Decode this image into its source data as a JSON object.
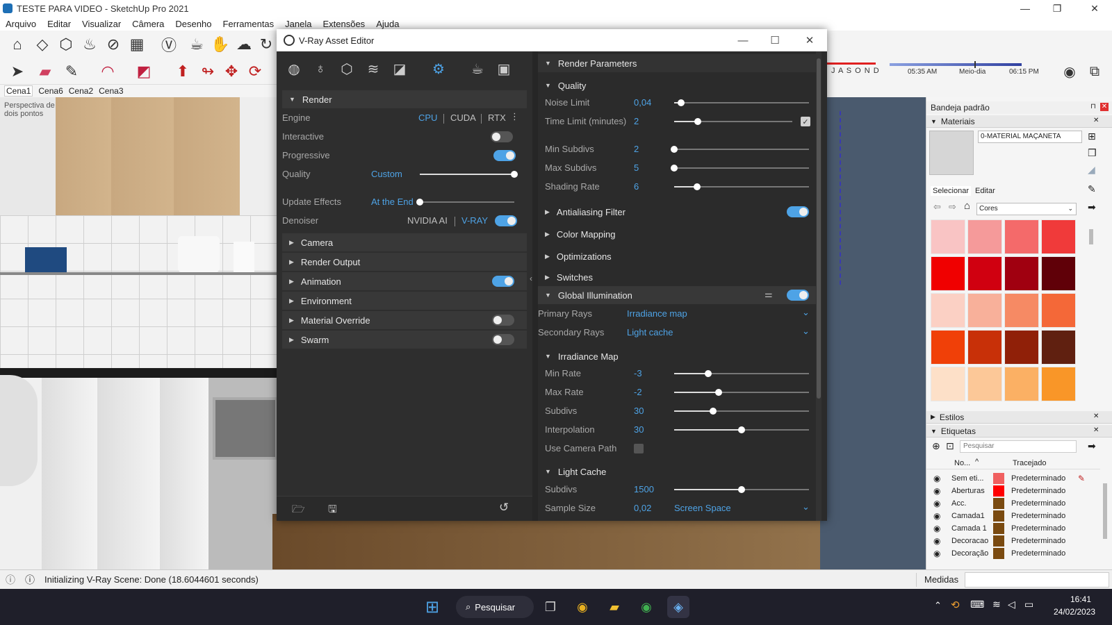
{
  "window": {
    "title": "TESTE PARA VIDEO - SketchUp Pro 2021",
    "minimize": "—",
    "maximize": "❐",
    "close": "✕"
  },
  "menu": [
    "Arquivo",
    "Editar",
    "Visualizar",
    "Câmera",
    "Desenho",
    "Ferramentas",
    "Janela",
    "Extensões",
    "Ajuda"
  ],
  "scenes": [
    "Cena1",
    "Cena6",
    "Cena2",
    "Cena3"
  ],
  "viewport": {
    "label": "Perspectiva de dois pontos"
  },
  "shadow": {
    "months": "J  A  S  O  N  D",
    "time_start": "05:35 AM",
    "time_mid": "Meio-dia",
    "time_end": "06:15 PM"
  },
  "vray": {
    "title": "V-Ray Asset Editor",
    "left": {
      "render": {
        "header": "Render",
        "engine_label": "Engine",
        "engine_cpu": "CPU",
        "engine_cuda": "CUDA",
        "engine_rtx": "RTX",
        "interactive_label": "Interactive",
        "interactive_on": false,
        "progressive_label": "Progressive",
        "progressive_on": true,
        "quality_label": "Quality",
        "quality_value": "Custom",
        "quality_level": 1.0,
        "update_label": "Update Effects",
        "update_value": "At the End",
        "update_level": 0.0,
        "denoiser_label": "Denoiser",
        "denoiser_nvidia": "NVIDIA AI",
        "denoiser_vray": "V-RAY",
        "denoiser_on": true
      },
      "sections": [
        {
          "label": "Camera",
          "toggle": null
        },
        {
          "label": "Render Output",
          "toggle": null
        },
        {
          "label": "Animation",
          "toggle": true
        },
        {
          "label": "Environment",
          "toggle": null
        },
        {
          "label": "Material Override",
          "toggle": false
        },
        {
          "label": "Swarm",
          "toggle": false
        }
      ]
    },
    "right": {
      "header": "Render Parameters",
      "quality": {
        "header": "Quality",
        "rows": [
          {
            "label": "Noise Limit",
            "value": "0,04",
            "level": 0.05
          },
          {
            "label": "Time Limit (minutes)",
            "value": "2",
            "level": 0.2
          },
          {
            "label": "Min Subdivs",
            "value": "2",
            "level": 0.0
          },
          {
            "label": "Max Subdivs",
            "value": "5",
            "level": 0.0
          },
          {
            "label": "Shading Rate",
            "value": "6",
            "level": 0.17
          }
        ]
      },
      "collapsed": [
        {
          "label": "Antialiasing Filter",
          "toggle": true
        },
        {
          "label": "Color Mapping",
          "toggle": null
        },
        {
          "label": "Optimizations",
          "toggle": null
        },
        {
          "label": "Switches",
          "toggle": null
        }
      ],
      "gi": {
        "header": "Global Illumination",
        "toggle": true,
        "primary_label": "Primary Rays",
        "primary_value": "Irradiance map",
        "secondary_label": "Secondary Rays",
        "secondary_value": "Light cache"
      },
      "irradiance": {
        "header": "Irradiance Map",
        "rows": [
          {
            "label": "Min Rate",
            "value": "-3",
            "level": 0.25
          },
          {
            "label": "Max Rate",
            "value": "-2",
            "level": 0.33
          },
          {
            "label": "Subdivs",
            "value": "30",
            "level": 0.29
          },
          {
            "label": "Interpolation",
            "value": "30",
            "level": 0.5
          }
        ],
        "camera_path_label": "Use Camera Path"
      },
      "lightcache": {
        "header": "Light Cache",
        "subdivs_label": "Subdivs",
        "subdivs_value": "1500",
        "subdivs_level": 0.5,
        "sample_label": "Sample Size",
        "sample_value": "0,02",
        "sample_mode": "Screen Space"
      }
    }
  },
  "tray": {
    "title": "Bandeja padrão",
    "materials_header": "Materiais",
    "material_name": "0-MATERIAL MAÇANETA",
    "tab_select": "Selecionar",
    "tab_edit": "Editar",
    "library": "Cores",
    "swatches": [
      "#f9c4c4",
      "#f59a9a",
      "#f46a6a",
      "#f03a3a",
      "#f00000",
      "#d00010",
      "#a00010",
      "#600008",
      "#fbd0c4",
      "#f8b09a",
      "#f68a64",
      "#f46838",
      "#f04008",
      "#c83008",
      "#902008",
      "#602010",
      "#fde0c8",
      "#fcc898",
      "#fbb064",
      "#f99628"
    ],
    "styles_header": "Estilos",
    "tags_header": "Etiquetas",
    "tags_search": "Pesquisar",
    "tags_col_name": "No...",
    "tags_col_dash": "Tracejado",
    "tags": [
      {
        "name": "Sem eti...",
        "color": "#f06060",
        "dash": "Predeterminado"
      },
      {
        "name": "Aberturas",
        "color": "#ff0000",
        "dash": "Predeterminado"
      },
      {
        "name": "Acc.",
        "color": "#7a4a10",
        "dash": "Predeterminado"
      },
      {
        "name": "Camada1",
        "color": "#7a4a10",
        "dash": "Predeterminado"
      },
      {
        "name": "Camada 1",
        "color": "#7a4a10",
        "dash": "Predeterminado"
      },
      {
        "name": "Decoracao",
        "color": "#7a4a10",
        "dash": "Predeterminado"
      },
      {
        "name": "Decoração",
        "color": "#7a4a10",
        "dash": "Predeterminado"
      }
    ]
  },
  "status": {
    "message": "Initializing V-Ray Scene: Done (18.6044601 seconds)",
    "measures": "Medidas"
  },
  "taskbar": {
    "search": "Pesquisar",
    "time": "16:41",
    "date": "24/02/2023"
  }
}
